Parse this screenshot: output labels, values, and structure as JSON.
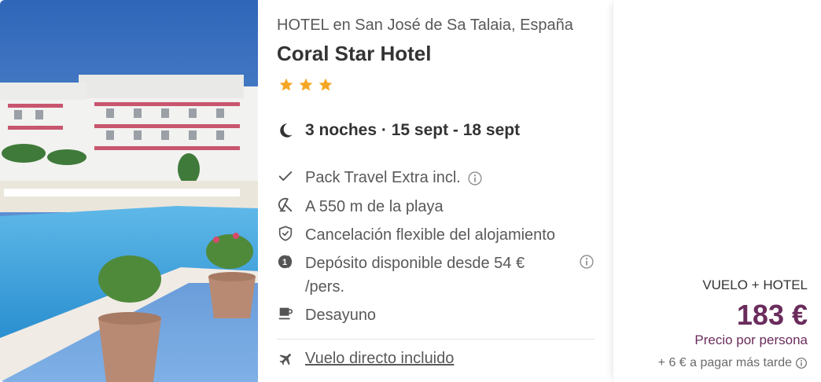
{
  "hotel": {
    "location": "HOTEL en San José de Sa Talaia, España",
    "name": "Coral Star Hotel",
    "stars": 3,
    "star_color": "#f5a623"
  },
  "stay": {
    "icon": "moon-icon",
    "text": "3 noches · 15 sept - 18 sept"
  },
  "features": [
    {
      "icon": "check-icon",
      "label": "Pack Travel Extra incl.",
      "has_info": true
    },
    {
      "icon": "beach-umbrella-icon",
      "label": "A 550 m de la playa"
    },
    {
      "icon": "shield-check-icon",
      "label": "Cancelación flexible del alojamiento"
    },
    {
      "icon": "deposit-icon",
      "label": "Depósito disponible desde 54 €",
      "label_line2": "/pers.",
      "has_info": true
    },
    {
      "icon": "coffee-cup-icon",
      "label": "Desayuno"
    }
  ],
  "flight": {
    "icon": "airplane-icon",
    "label": "Vuelo directo incluido"
  },
  "price": {
    "package_type": "VUELO + HOTEL",
    "amount": "183 €",
    "per_person": "Precio por persona",
    "pay_later": "+ 6 € a pagar más tarde",
    "accent_color": "#6a2c5d"
  }
}
